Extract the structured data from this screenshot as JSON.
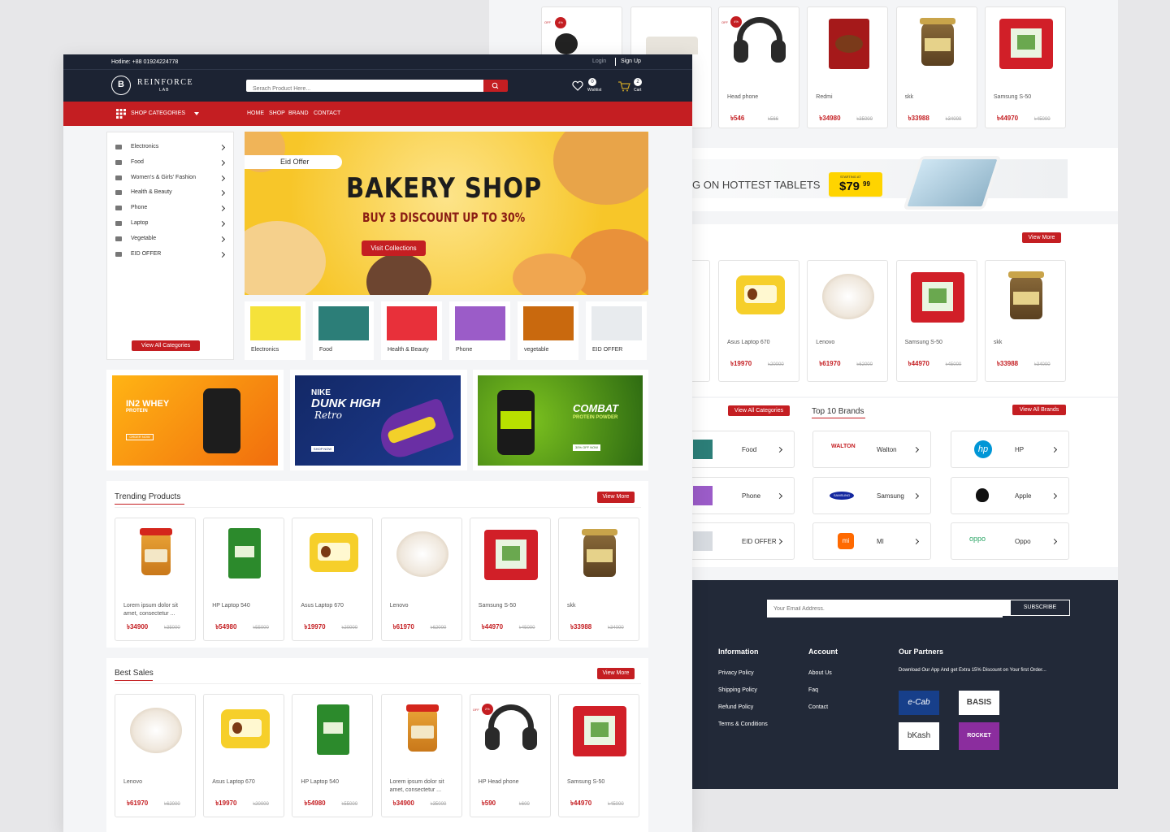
{
  "header": {
    "hotline": "Hotline: +88 01924224778",
    "login": "Login",
    "signup": "Sign Up",
    "brand": "REINFORCE",
    "brand_sub": "LAB",
    "search_placeholder": "Serach Product Here...",
    "wishlist_label": "Wishlist",
    "wishlist_count": "0",
    "cart_label": "Cart",
    "cart_count": "2"
  },
  "nav": {
    "categories_label": "SHOP CATEGORIES",
    "links": [
      "HOME",
      "SHOP",
      "BRAND",
      "CONTACT"
    ]
  },
  "sidebar": {
    "items": [
      "Electronics",
      "Food",
      "Women's & Girls' Fashion",
      "Health & Beauty",
      "Phone",
      "Laptop",
      "Vegetable",
      "EID OFFER"
    ],
    "button": "View All Categories"
  },
  "hero": {
    "tag": "Eid Offer",
    "title": "BAKERY SHOP",
    "subtitle": "BUY 3 DISCOUNT UP TO 30%",
    "button": "Visit Collections"
  },
  "category_tiles": [
    "Electronics",
    "Food",
    "Health & Beauty",
    "Phone",
    "vegetable",
    "EID OFFER"
  ],
  "promos": [
    {
      "title": "IN2 WHEY",
      "sub": "PROTEIN",
      "cta": "ORDER NOW"
    },
    {
      "title": "NIKE",
      "sub": "DUNK HIGH",
      "script": "Retro",
      "cta": "SHOP NOW"
    },
    {
      "title": "COMBAT",
      "sub": "PROTEIN POWDER",
      "cta": "30% OFF NOW"
    }
  ],
  "trending": {
    "title": "Trending Products",
    "button": "View More",
    "items": [
      {
        "name": "Lorem ipsum dolor sit amet, consectetur ...",
        "price": "৳34900",
        "old": "৳35000"
      },
      {
        "name": "HP Laptop 540",
        "price": "৳54980",
        "old": "৳55000"
      },
      {
        "name": "Asus Laptop 670",
        "price": "৳19970",
        "old": "৳20000"
      },
      {
        "name": "Lenovo",
        "price": "৳61970",
        "old": "৳62000"
      },
      {
        "name": "Samsung S-50",
        "price": "৳44970",
        "old": "৳45000"
      },
      {
        "name": "skk",
        "price": "৳33988",
        "old": "৳34000"
      }
    ]
  },
  "best_sales": {
    "title": "Best Sales",
    "button": "View More",
    "items": [
      {
        "name": "Lenovo",
        "price": "৳61970",
        "old": "৳62000"
      },
      {
        "name": "Asus Laptop 670",
        "price": "৳19970",
        "old": "৳20000"
      },
      {
        "name": "HP Laptop 540",
        "price": "৳54980",
        "old": "৳55000"
      },
      {
        "name": "Lorem ipsum dolor sit amet, consectetur ...",
        "price": "৳34900",
        "old": "৳35000"
      },
      {
        "name": "HP Head phone",
        "price": "৳590",
        "old": "৳600",
        "off": "OFF",
        "pct": "2%"
      },
      {
        "name": "Samsung S-50",
        "price": "৳44970",
        "old": "৳45000"
      }
    ]
  },
  "back": {
    "top_items": [
      {
        "name": "Head phone",
        "price": "৳546",
        "old": "৳566",
        "off": "OFF",
        "pct": "4%"
      },
      {
        "name": "Redmi",
        "price": "৳34980",
        "old": "৳35000"
      },
      {
        "name": "skk",
        "price": "৳33988",
        "old": "৳34000"
      },
      {
        "name": "Samsung S-50",
        "price": "৳44970",
        "old": "৳45000"
      }
    ],
    "first_off": {
      "off": "OFF",
      "pct": "4%"
    },
    "tablet_text": "G ON HOTTEST TABLETS",
    "starting_at": "STARTING AT",
    "tablet_price": "$79",
    "tablet_cents": "99",
    "mid_button": "View More",
    "mid_items": [
      {
        "name": "Asus Laptop 670",
        "price": "৳19970",
        "old": "৳20000"
      },
      {
        "name": "Lenovo",
        "price": "৳61970",
        "old": "৳62000"
      },
      {
        "name": "Samsung S-50",
        "price": "৳44970",
        "old": "৳45000"
      },
      {
        "name": "skk",
        "price": "৳33988",
        "old": "৳34000"
      }
    ],
    "cat_button": "View All Categories",
    "categories": [
      "Food",
      "Phone",
      "EID OFFER"
    ],
    "brands_title": "Top 10 Brands",
    "brands_button": "View All Brands",
    "brands": [
      "Walton",
      "HP",
      "Samsung",
      "Apple",
      "MI",
      "Oppo"
    ],
    "brand_logos": {
      "walton": "WALTON",
      "samsung": "SAMSUNG",
      "oppo": "oppo",
      "mi": "mi",
      "hp": "hp"
    },
    "email_placeholder": "Your Email Address.",
    "subscribe": "SUBSCRIBE",
    "footer": {
      "information": "Information",
      "info_links": [
        "Privacy Policy",
        "Shipping Policy",
        "Refund Policy",
        "Terms & Conditions"
      ],
      "account": "Account",
      "account_links": [
        "About Us",
        "Faq",
        "Contact"
      ],
      "partners": "Our Partners",
      "partners_text": "Download Our App And get Extra 15% Discount on Your first Order...",
      "partner_logos": [
        "e-Cab",
        "BASIS",
        "bKash",
        "ROCKET"
      ]
    }
  }
}
